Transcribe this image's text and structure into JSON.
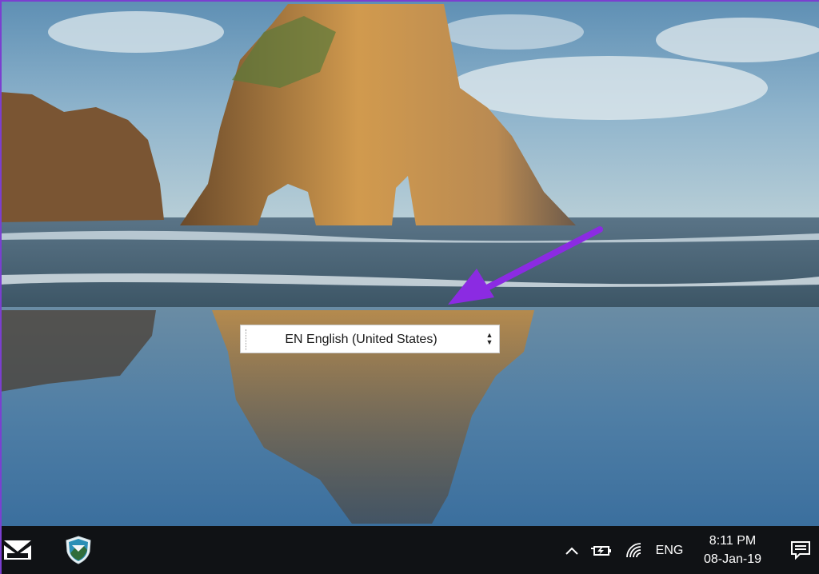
{
  "language_bar": {
    "text": "EN English (United States)",
    "spinner_up": "▲",
    "spinner_down": "▼"
  },
  "taskbar": {
    "start_icon": "inbox-tray-icon",
    "app_icon": "shield-logo-icon",
    "show_hidden_icon": "chevron-up-icon",
    "battery_icon": "battery-charging-icon",
    "network_icon": "wifi-icon",
    "input_indicator": "ENG",
    "time": "8:11 PM",
    "date": "08-Jan-19",
    "notifications_icon": "action-center-icon"
  },
  "colors": {
    "annotation_arrow": "#8b2be2",
    "taskbar_bg": "#101215",
    "frame": "#7b3fd0"
  }
}
